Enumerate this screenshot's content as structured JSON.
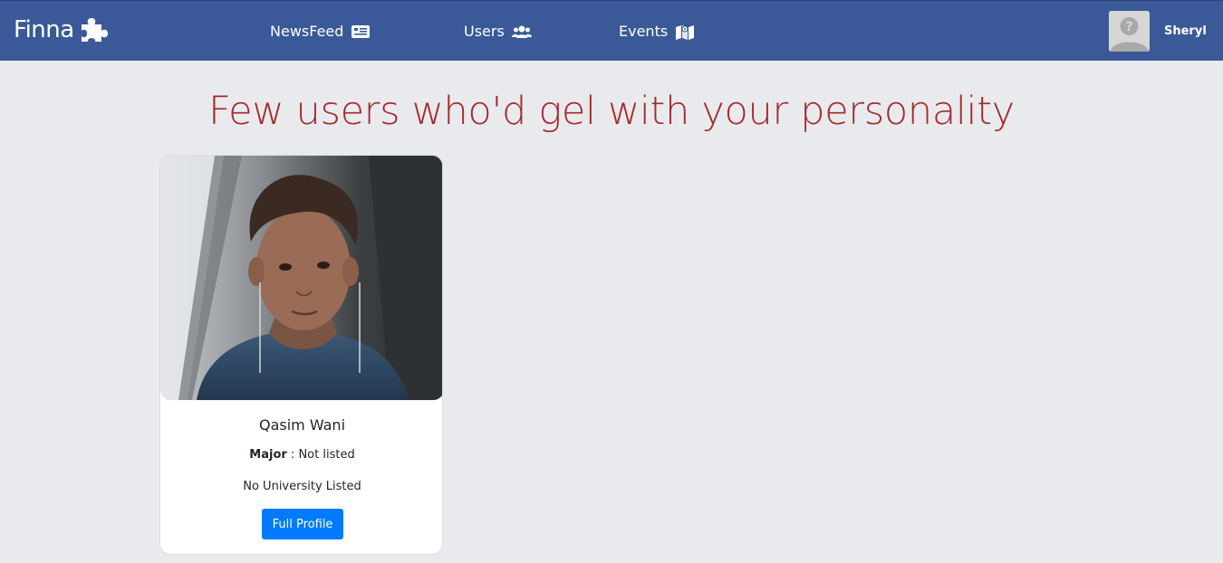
{
  "navbar": {
    "brand": "Finna",
    "brand_icon": "puzzle-icon",
    "links": [
      {
        "label": "NewsFeed",
        "icon": "newspaper-icon"
      },
      {
        "label": "Users",
        "icon": "users-icon"
      },
      {
        "label": "Events",
        "icon": "map-icon"
      }
    ],
    "user": {
      "name": "Sheryl",
      "avatar": "default-avatar-icon"
    }
  },
  "main": {
    "title": "Few users who'd gel with your personality",
    "cards": [
      {
        "name": "Qasim Wani",
        "major_label": "Major",
        "major_value": "Not listed",
        "university": "No University Listed",
        "button_label": "Full Profile"
      }
    ]
  },
  "colors": {
    "navbar": "#3b5998",
    "background": "#e9eaee",
    "title": "#a52a2a",
    "button": "#007bff"
  }
}
